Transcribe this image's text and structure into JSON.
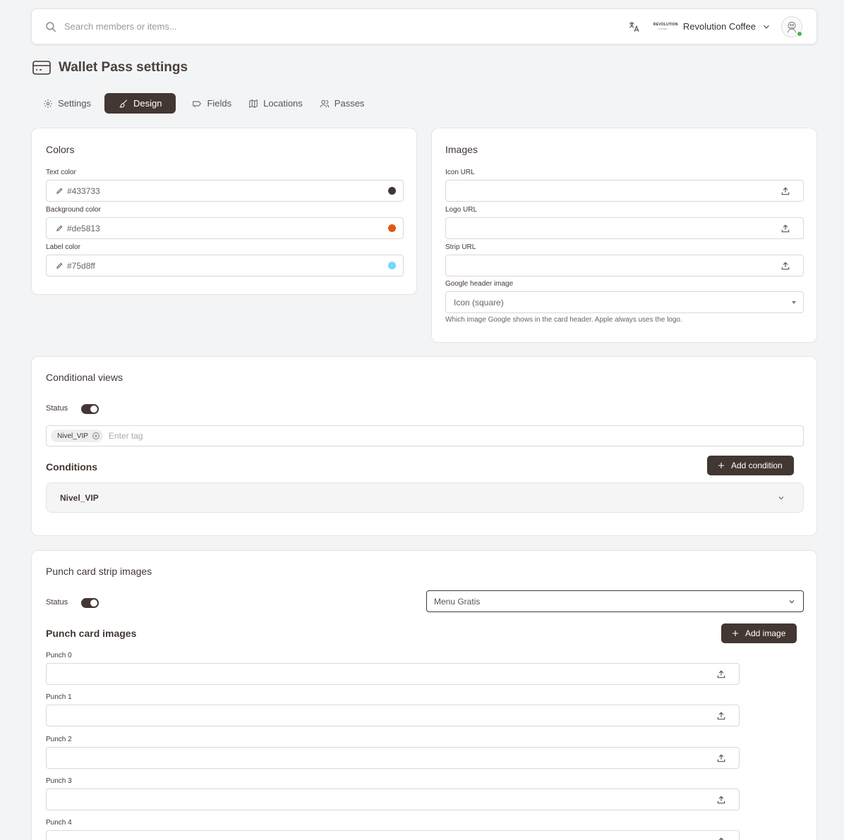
{
  "search": {
    "placeholder": "Search members or items..."
  },
  "org": {
    "logo_text": "REVOLUTION",
    "logo_sub": "COFFEE",
    "name": "Revolution Coffee"
  },
  "page": {
    "title": "Wallet Pass settings"
  },
  "tabs": [
    {
      "label": "Settings",
      "icon": "gear-icon"
    },
    {
      "label": "Design",
      "icon": "brush-icon",
      "active": true
    },
    {
      "label": "Fields",
      "icon": "tag-icon"
    },
    {
      "label": "Locations",
      "icon": "map-icon"
    },
    {
      "label": "Passes",
      "icon": "users-icon"
    }
  ],
  "colors": {
    "title": "Colors",
    "text_color": {
      "label": "Text color",
      "value": "#433733",
      "swatch": "#433733"
    },
    "background_color": {
      "label": "Background color",
      "value": "#de5813",
      "swatch": "#de5813"
    },
    "label_color": {
      "label": "Label color",
      "value": "#75d8ff",
      "swatch": "#75d8ff"
    }
  },
  "images": {
    "title": "Images",
    "icon_url": {
      "label": "Icon URL",
      "value": ""
    },
    "logo_url": {
      "label": "Logo URL",
      "value": ""
    },
    "strip_url": {
      "label": "Strip URL",
      "value": ""
    },
    "google_header": {
      "label": "Google header image",
      "value": "Icon (square)",
      "helper": "Which image Google shows in the card header. Apple always uses the logo."
    }
  },
  "conditional": {
    "title": "Conditional views",
    "status_label": "Status",
    "status_on": true,
    "tags": [
      "Nivel_VIP"
    ],
    "tag_placeholder": "Enter tag",
    "conditions_heading": "Conditions",
    "add_condition_label": "Add condition",
    "conditions": [
      "Nivel_VIP"
    ]
  },
  "punch": {
    "title": "Punch card strip images",
    "status_label": "Status",
    "status_on": true,
    "selected_reward": "Menu Gratis",
    "images_heading": "Punch card images",
    "add_image_label": "Add image",
    "punches": [
      {
        "label": "Punch 0",
        "value": ""
      },
      {
        "label": "Punch 1",
        "value": ""
      },
      {
        "label": "Punch 2",
        "value": ""
      },
      {
        "label": "Punch 3",
        "value": ""
      },
      {
        "label": "Punch 4",
        "value": ""
      }
    ]
  }
}
